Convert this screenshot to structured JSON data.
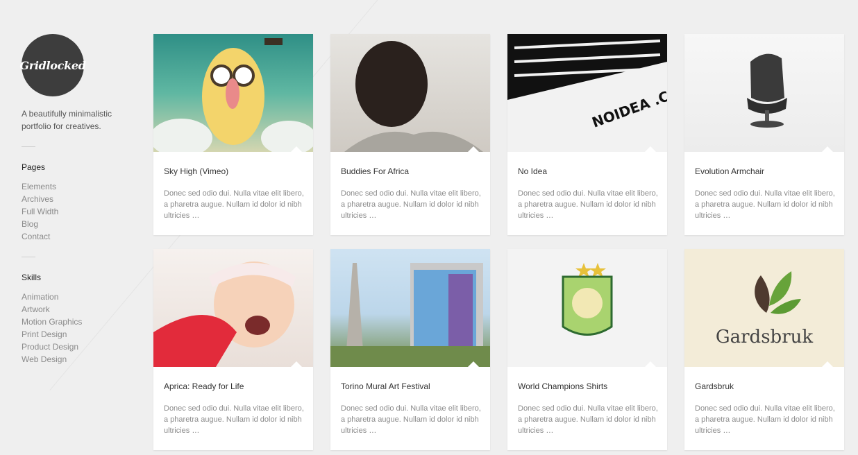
{
  "sidebar": {
    "logo_text": "Gridlocked",
    "tagline": "A beautifully minimalistic portfolio for creatives.",
    "pages_title": "Pages",
    "pages": [
      "Elements",
      "Archives",
      "Full Width",
      "Blog",
      "Contact"
    ],
    "skills_title": "Skills",
    "skills": [
      "Animation",
      "Artwork",
      "Motion Graphics",
      "Print Design",
      "Product Design",
      "Web Design"
    ]
  },
  "cards": [
    {
      "title": "Sky High (Vimeo)",
      "excerpt": "Donec sed odio dui. Nulla vitae elit libero, a pharetra augue. Nullam id dolor id nibh ultricies …"
    },
    {
      "title": "Buddies For Africa",
      "excerpt": "Donec sed odio dui. Nulla vitae elit libero, a pharetra augue. Nullam id dolor id nibh ultricies …"
    },
    {
      "title": "No Idea",
      "excerpt": "Donec sed odio dui. Nulla vitae elit libero, a pharetra augue. Nullam id dolor id nibh ultricies …"
    },
    {
      "title": "Evolution Armchair",
      "excerpt": "Donec sed odio dui. Nulla vitae elit libero, a pharetra augue. Nullam id dolor id nibh ultricies …"
    },
    {
      "title": "Aprica: Ready for Life",
      "excerpt": "Donec sed odio dui. Nulla vitae elit libero, a pharetra augue. Nullam id dolor id nibh ultricies …"
    },
    {
      "title": "Torino Mural Art Festival",
      "excerpt": "Donec sed odio dui. Nulla vitae elit libero, a pharetra augue. Nullam id dolor id nibh ultricies …"
    },
    {
      "title": "World Champions Shirts",
      "excerpt": "Donec sed odio dui. Nulla vitae elit libero, a pharetra augue. Nullam id dolor id nibh ultricies …"
    },
    {
      "title": "Gardsbruk",
      "excerpt": "Donec sed odio dui. Nulla vitae elit libero, a pharetra augue. Nullam id dolor id nibh ultricies …"
    }
  ],
  "images": {
    "noidea_text": "NOIDEA .CO.UK",
    "gardsbruk_text": "Gardsbruk"
  }
}
